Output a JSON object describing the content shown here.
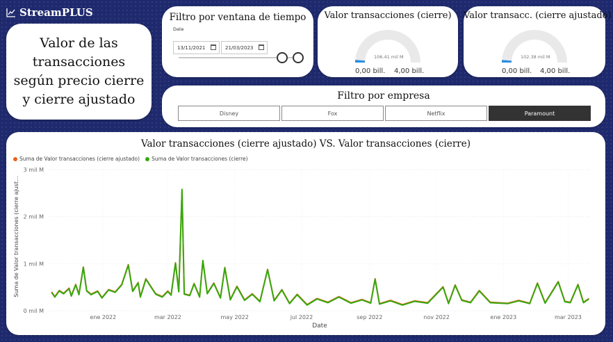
{
  "brand": {
    "name": "StreamPLUS",
    "icon": "line-chart-icon"
  },
  "title_card": {
    "lines": [
      "Valor de las",
      "transacciones",
      "según precio cierre",
      "y cierre ajustado"
    ]
  },
  "time_filter": {
    "title": "Filtro por ventana de tiempo",
    "date_label": "Date",
    "start": "13/11/2021",
    "end": "21/03/2023"
  },
  "gauges": [
    {
      "title": "Valor transacciones (cierre)",
      "value_label": "106.41 mil M",
      "min_label": "0,00 bill.",
      "max_label": "4,00 bill.",
      "value": 106.41,
      "min": 0,
      "max": 4000
    },
    {
      "title": "Valor transacc. (cierre ajustado)",
      "value_label": "102.38 mil M",
      "min_label": "0,00 bill.",
      "max_label": "4,00 bill.",
      "value": 102.38,
      "min": 0,
      "max": 4000
    }
  ],
  "company_filter": {
    "title": "Filtro por empresa",
    "options": [
      "Disney",
      "Fox",
      "Netflix",
      "Paramount"
    ],
    "selected": "Paramount"
  },
  "colors": {
    "adjusted": "#e8631d",
    "close": "#36a80d",
    "gauge_fill": "#2b8de0",
    "gauge_bg": "#e9e9e9",
    "background": "#1f2a6e"
  },
  "chart_data": {
    "type": "line",
    "title": "Valor transacciones (cierre ajustado) VS. Valor transacciones (cierre)",
    "xlabel": "Date",
    "ylabel": "Suma de Valor transacciones (cierre ajust...",
    "x_ticks": [
      "ene 2022",
      "mar 2022",
      "may 2022",
      "jul 2022",
      "sep 2022",
      "nov 2022",
      "ene 2023",
      "mar 2023"
    ],
    "y_ticks": [
      "0 mil M",
      "1 mil M",
      "2 mil M",
      "3 mil M"
    ],
    "ylim": [
      0,
      3000
    ],
    "xlim": [
      "2021-11-13",
      "2023-03-21"
    ],
    "grid": true,
    "legend": "top-left",
    "series": [
      {
        "name": "Suma de Valor transacciones (cierre ajustado)",
        "points": [
          [
            "2021-11-15",
            400
          ],
          [
            "2021-11-18",
            300
          ],
          [
            "2021-11-22",
            430
          ],
          [
            "2021-11-26",
            370
          ],
          [
            "2021-12-01",
            480
          ],
          [
            "2021-12-03",
            320
          ],
          [
            "2021-12-07",
            560
          ],
          [
            "2021-12-10",
            350
          ],
          [
            "2021-12-14",
            930
          ],
          [
            "2021-12-17",
            430
          ],
          [
            "2021-12-21",
            350
          ],
          [
            "2021-12-27",
            420
          ],
          [
            "2021-12-31",
            280
          ],
          [
            "2022-01-06",
            450
          ],
          [
            "2022-01-12",
            400
          ],
          [
            "2022-01-18",
            560
          ],
          [
            "2022-01-24",
            980
          ],
          [
            "2022-01-28",
            420
          ],
          [
            "2022-02-02",
            600
          ],
          [
            "2022-02-04",
            300
          ],
          [
            "2022-02-09",
            680
          ],
          [
            "2022-02-14",
            500
          ],
          [
            "2022-02-18",
            360
          ],
          [
            "2022-02-24",
            300
          ],
          [
            "2022-03-01",
            420
          ],
          [
            "2022-03-04",
            340
          ],
          [
            "2022-03-08",
            1020
          ],
          [
            "2022-03-11",
            410
          ],
          [
            "2022-03-14",
            2540
          ],
          [
            "2022-03-16",
            360
          ],
          [
            "2022-03-21",
            330
          ],
          [
            "2022-03-25",
            580
          ],
          [
            "2022-03-30",
            300
          ],
          [
            "2022-04-02",
            1060
          ],
          [
            "2022-04-06",
            370
          ],
          [
            "2022-04-12",
            590
          ],
          [
            "2022-04-18",
            280
          ],
          [
            "2022-04-22",
            920
          ],
          [
            "2022-04-27",
            240
          ],
          [
            "2022-05-03",
            520
          ],
          [
            "2022-05-10",
            230
          ],
          [
            "2022-05-17",
            360
          ],
          [
            "2022-05-24",
            200
          ],
          [
            "2022-05-31",
            880
          ],
          [
            "2022-06-06",
            220
          ],
          [
            "2022-06-13",
            450
          ],
          [
            "2022-06-20",
            160
          ],
          [
            "2022-06-27",
            350
          ],
          [
            "2022-07-06",
            130
          ],
          [
            "2022-07-15",
            260
          ],
          [
            "2022-07-25",
            180
          ],
          [
            "2022-08-04",
            300
          ],
          [
            "2022-08-15",
            170
          ],
          [
            "2022-08-25",
            240
          ],
          [
            "2022-09-02",
            170
          ],
          [
            "2022-09-06",
            680
          ],
          [
            "2022-09-10",
            150
          ],
          [
            "2022-09-20",
            220
          ],
          [
            "2022-10-01",
            130
          ],
          [
            "2022-10-12",
            210
          ],
          [
            "2022-10-24",
            170
          ],
          [
            "2022-11-07",
            510
          ],
          [
            "2022-11-12",
            160
          ],
          [
            "2022-11-18",
            550
          ],
          [
            "2022-11-24",
            230
          ],
          [
            "2022-12-02",
            180
          ],
          [
            "2022-12-10",
            430
          ],
          [
            "2022-12-20",
            180
          ],
          [
            "2023-01-05",
            160
          ],
          [
            "2023-01-15",
            220
          ],
          [
            "2023-01-25",
            160
          ],
          [
            "2023-02-01",
            590
          ],
          [
            "2023-02-08",
            170
          ],
          [
            "2023-02-20",
            620
          ],
          [
            "2023-02-26",
            200
          ],
          [
            "2023-03-03",
            180
          ],
          [
            "2023-03-10",
            560
          ],
          [
            "2023-03-15",
            180
          ],
          [
            "2023-03-20",
            260
          ]
        ]
      },
      {
        "name": "Suma de Valor transacciones (cierre)",
        "points": [
          [
            "2021-11-15",
            390
          ],
          [
            "2021-11-18",
            290
          ],
          [
            "2021-11-22",
            420
          ],
          [
            "2021-11-26",
            360
          ],
          [
            "2021-12-01",
            470
          ],
          [
            "2021-12-03",
            310
          ],
          [
            "2021-12-07",
            550
          ],
          [
            "2021-12-10",
            340
          ],
          [
            "2021-12-14",
            920
          ],
          [
            "2021-12-17",
            420
          ],
          [
            "2021-12-21",
            340
          ],
          [
            "2021-12-27",
            410
          ],
          [
            "2021-12-31",
            270
          ],
          [
            "2022-01-06",
            440
          ],
          [
            "2022-01-12",
            390
          ],
          [
            "2022-01-18",
            550
          ],
          [
            "2022-01-24",
            970
          ],
          [
            "2022-01-28",
            410
          ],
          [
            "2022-02-02",
            590
          ],
          [
            "2022-02-04",
            290
          ],
          [
            "2022-02-09",
            670
          ],
          [
            "2022-02-14",
            490
          ],
          [
            "2022-02-18",
            350
          ],
          [
            "2022-02-24",
            290
          ],
          [
            "2022-03-01",
            410
          ],
          [
            "2022-03-04",
            330
          ],
          [
            "2022-03-08",
            1010
          ],
          [
            "2022-03-11",
            400
          ],
          [
            "2022-03-14",
            2580
          ],
          [
            "2022-03-16",
            350
          ],
          [
            "2022-03-21",
            320
          ],
          [
            "2022-03-25",
            570
          ],
          [
            "2022-03-30",
            290
          ],
          [
            "2022-04-02",
            1070
          ],
          [
            "2022-04-06",
            360
          ],
          [
            "2022-04-12",
            580
          ],
          [
            "2022-04-18",
            270
          ],
          [
            "2022-04-22",
            910
          ],
          [
            "2022-04-27",
            230
          ],
          [
            "2022-05-03",
            510
          ],
          [
            "2022-05-10",
            220
          ],
          [
            "2022-05-17",
            350
          ],
          [
            "2022-05-24",
            190
          ],
          [
            "2022-05-31",
            870
          ],
          [
            "2022-06-06",
            210
          ],
          [
            "2022-06-13",
            440
          ],
          [
            "2022-06-20",
            150
          ],
          [
            "2022-06-27",
            340
          ],
          [
            "2022-07-06",
            120
          ],
          [
            "2022-07-15",
            250
          ],
          [
            "2022-07-25",
            170
          ],
          [
            "2022-08-04",
            290
          ],
          [
            "2022-08-15",
            160
          ],
          [
            "2022-08-25",
            230
          ],
          [
            "2022-09-02",
            160
          ],
          [
            "2022-09-06",
            670
          ],
          [
            "2022-09-10",
            140
          ],
          [
            "2022-09-20",
            210
          ],
          [
            "2022-10-01",
            120
          ],
          [
            "2022-10-12",
            200
          ],
          [
            "2022-10-24",
            160
          ],
          [
            "2022-11-07",
            500
          ],
          [
            "2022-11-12",
            150
          ],
          [
            "2022-11-18",
            540
          ],
          [
            "2022-11-24",
            220
          ],
          [
            "2022-12-02",
            170
          ],
          [
            "2022-12-10",
            420
          ],
          [
            "2022-12-20",
            170
          ],
          [
            "2023-01-05",
            150
          ],
          [
            "2023-01-15",
            210
          ],
          [
            "2023-01-25",
            150
          ],
          [
            "2023-02-01",
            580
          ],
          [
            "2023-02-08",
            160
          ],
          [
            "2023-02-20",
            610
          ],
          [
            "2023-02-26",
            190
          ],
          [
            "2023-03-03",
            170
          ],
          [
            "2023-03-10",
            550
          ],
          [
            "2023-03-15",
            170
          ],
          [
            "2023-03-20",
            250
          ]
        ]
      }
    ]
  }
}
